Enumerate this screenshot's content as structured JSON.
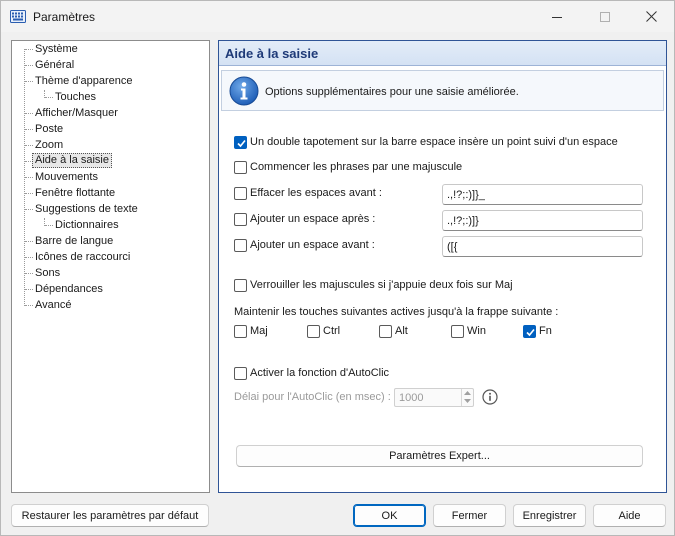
{
  "window": {
    "title": "Paramètres"
  },
  "tree": {
    "items": [
      {
        "label": "Système",
        "level": 0
      },
      {
        "label": "Général",
        "level": 0
      },
      {
        "label": "Thème d'apparence",
        "level": 0
      },
      {
        "label": "Touches",
        "level": 1
      },
      {
        "label": "Afficher/Masquer",
        "level": 0
      },
      {
        "label": "Poste",
        "level": 0
      },
      {
        "label": "Zoom",
        "level": 0
      },
      {
        "label": "Aide à la saisie",
        "level": 0,
        "selected": true
      },
      {
        "label": "Mouvements",
        "level": 0
      },
      {
        "label": "Fenêtre flottante",
        "level": 0
      },
      {
        "label": "Suggestions de texte",
        "level": 0
      },
      {
        "label": "Dictionnaires",
        "level": 1
      },
      {
        "label": "Barre de langue",
        "level": 0
      },
      {
        "label": "Icônes de raccourci",
        "level": 0
      },
      {
        "label": "Sons",
        "level": 0
      },
      {
        "label": "Dépendances",
        "level": 0
      },
      {
        "label": "Avancé",
        "level": 0
      }
    ]
  },
  "panel": {
    "title": "Aide à la saisie",
    "info_text": "Options supplémentaires pour une saisie améliorée.",
    "double_tap": {
      "label": "Un double tapotement sur la barre espace insère un point suivi d'un espace",
      "checked": true
    },
    "capitalize": {
      "label": "Commencer les phrases par une majuscule",
      "checked": false
    },
    "erase_before": {
      "label": "Effacer les espaces avant :",
      "checked": false,
      "value": ".,!?;:)]}_"
    },
    "space_after": {
      "label": "Ajouter un espace après :",
      "checked": false,
      "value": ".,!?;:)]}"
    },
    "space_before": {
      "label": "Ajouter un espace avant :",
      "checked": false,
      "value": "([{"
    },
    "caps_lock": {
      "label": "Verrouiller les majuscules si j'appuie deux fois sur Maj",
      "checked": false
    },
    "sticky_label": "Maintenir les touches suivantes actives jusqu'à la frappe suivante :",
    "sticky_keys": [
      {
        "label": "Maj",
        "checked": false
      },
      {
        "label": "Ctrl",
        "checked": false
      },
      {
        "label": "Alt",
        "checked": false
      },
      {
        "label": "Win",
        "checked": false
      },
      {
        "label": "Fn",
        "checked": true
      }
    ],
    "autoclick": {
      "label": "Activer la fonction d'AutoClic",
      "checked": false
    },
    "autoclick_delay_label": "Délai pour l'AutoClic (en msec) :",
    "autoclick_delay_value": "1000",
    "expert_button": "Paramètres Expert..."
  },
  "footer": {
    "restore": "Restaurer les paramètres par défaut",
    "ok": "OK",
    "close": "Fermer",
    "save": "Enregistrer",
    "help": "Aide"
  },
  "colors": {
    "accent": "#0060c0",
    "panel_border": "#2f5496",
    "header_title": "#1e3a78"
  }
}
